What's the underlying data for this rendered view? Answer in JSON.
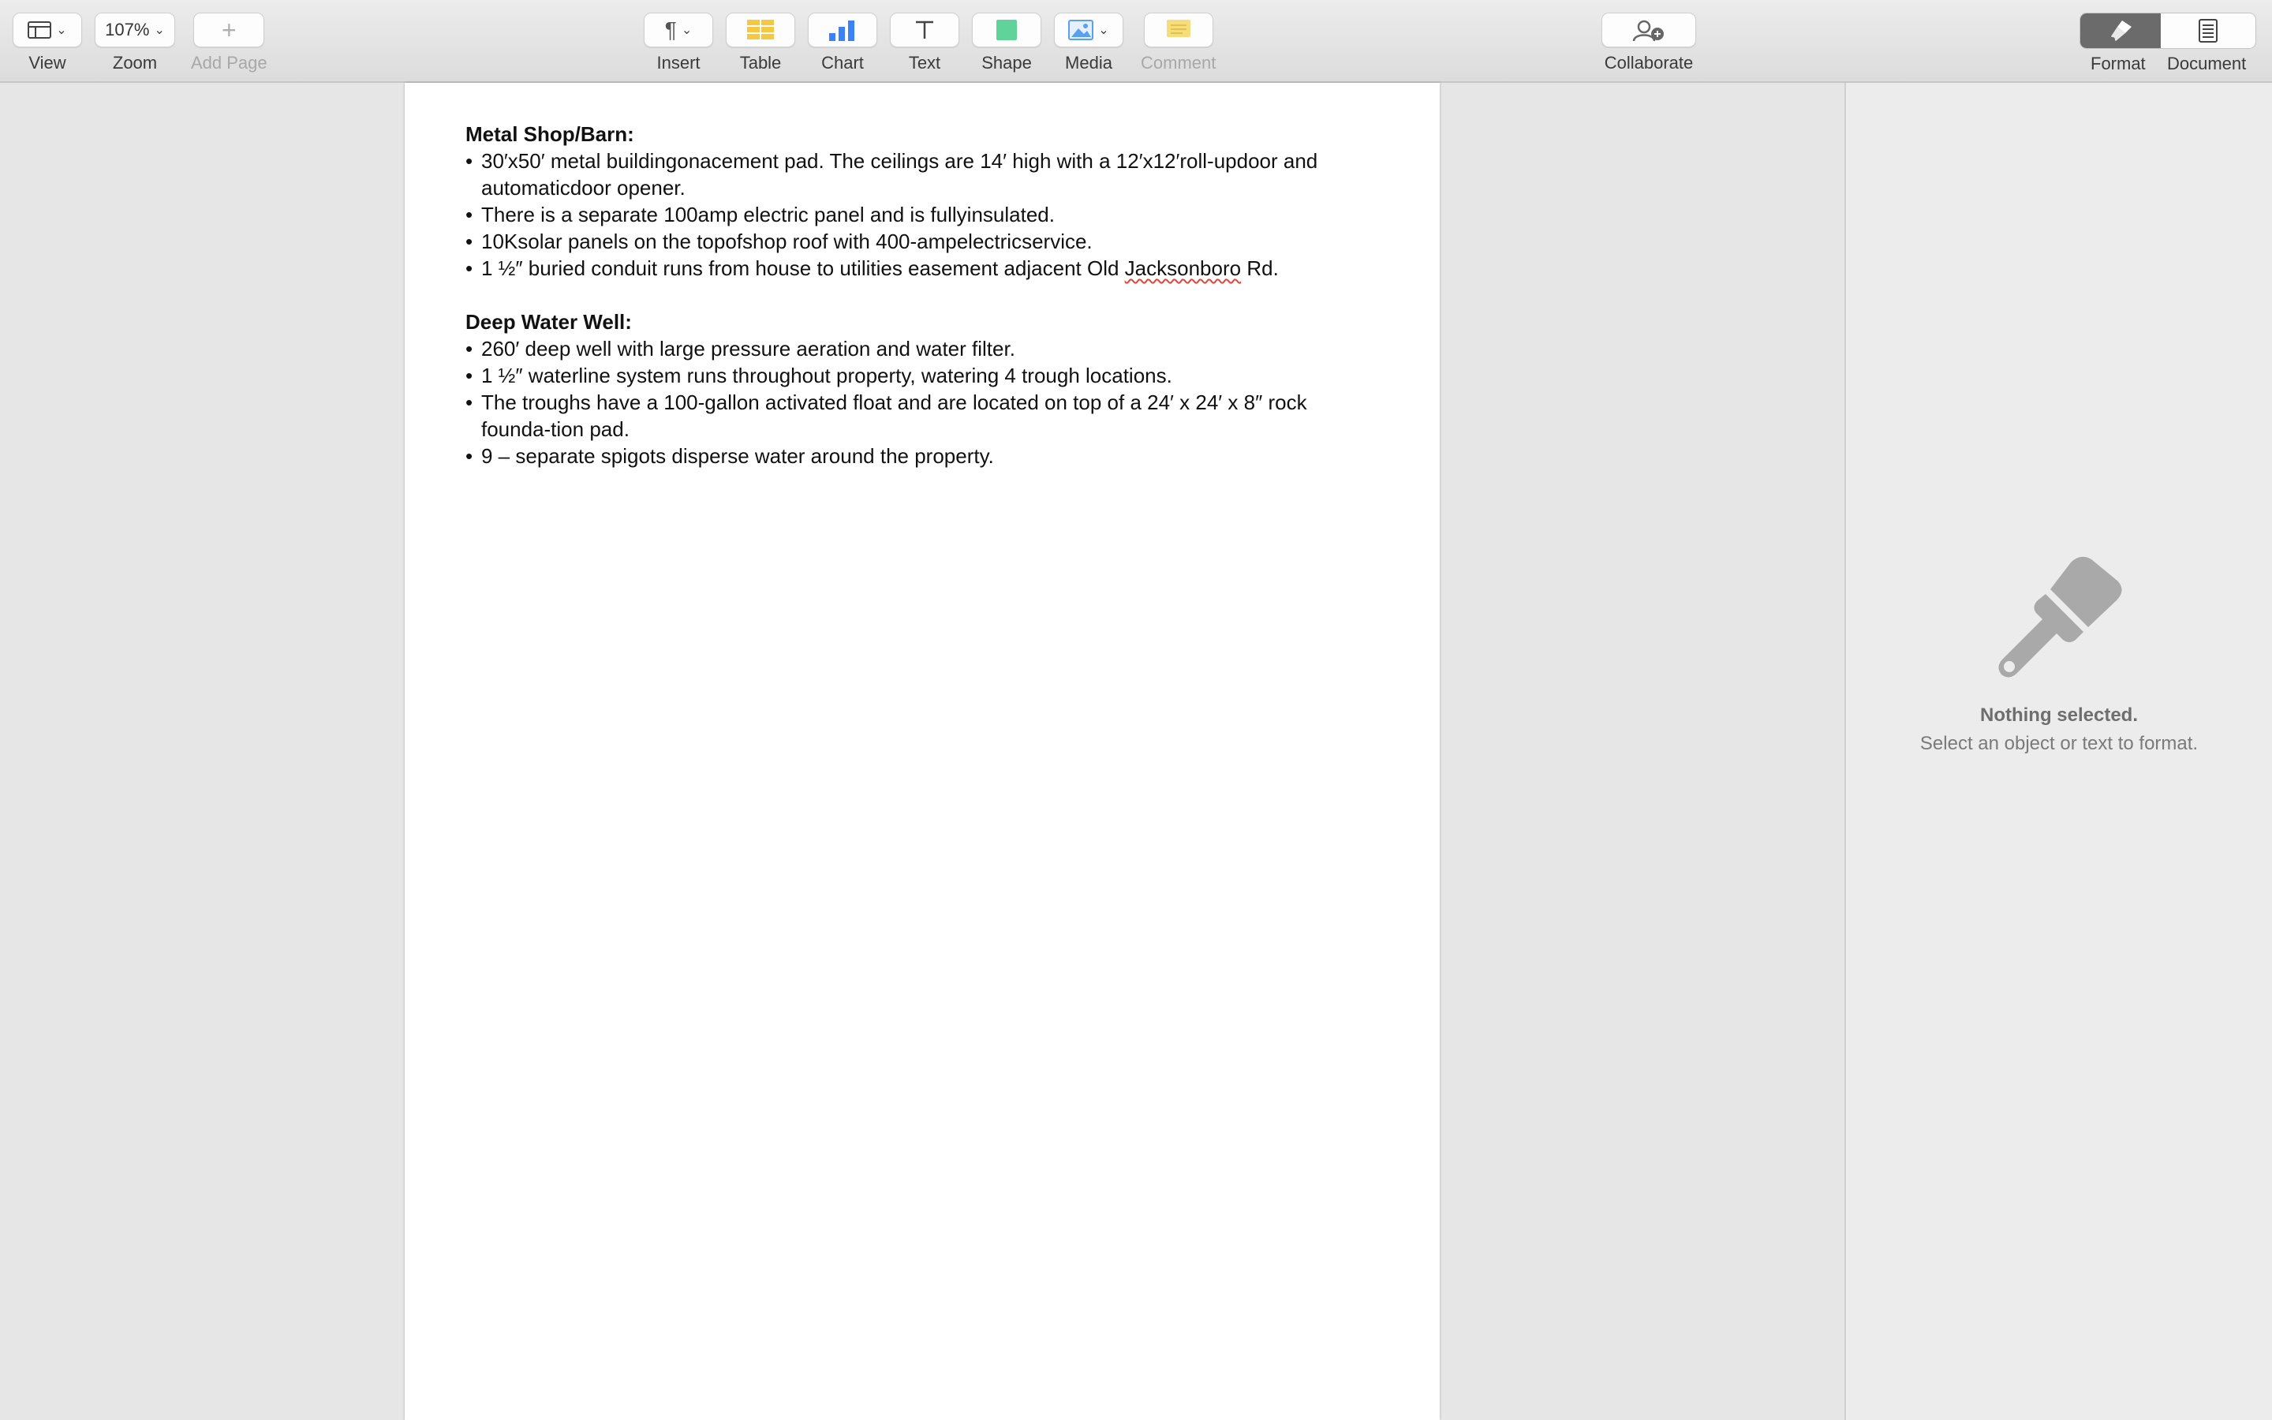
{
  "toolbar": {
    "view_label": "View",
    "zoom_label": "Zoom",
    "zoom_value": "107%",
    "add_page_label": "Add Page",
    "insert_label": "Insert",
    "table_label": "Table",
    "chart_label": "Chart",
    "text_label": "Text",
    "shape_label": "Shape",
    "media_label": "Media",
    "comment_label": "Comment",
    "collaborate_label": "Collaborate",
    "format_label": "Format",
    "document_label": "Document",
    "colors": {
      "table": "#f5c842",
      "chart": "#3b82f6",
      "shape": "#5fd39a",
      "media": "#5aa0f0",
      "comment": "#f7dc7a"
    }
  },
  "document": {
    "section1": {
      "heading": "Metal Shop/Barn:",
      "bullets": [
        "30′x50′ metal buildingonacement pad.  The ceilings are 14′ high with a 12′x12′roll-updoor and automaticdoor opener.",
        "There is a separate 100amp  electric panel and is fullyinsulated.",
        "10Ksolar panels on the topofshop roof with 400-ampelectricservice.",
        "1 ½″ buried conduit runs from house to utilities easement adjacent Old",
        "Jacksonboro",
        "Rd."
      ]
    },
    "section2": {
      "heading": "Deep Water Well:",
      "bullets": [
        "260′ deep well with large pressure aeration and water filter.",
        "1 ½″ waterline system runs throughout property, watering 4  trough locations.",
        "The troughs have a 100-gallon activated float and are located on top of a 24′ x 24′ x 8″ rock founda-tion pad.",
        "9 – separate spigots disperse water around the  property."
      ]
    },
    "bullet_char": "•"
  },
  "inspector": {
    "title": "Nothing selected.",
    "subtitle": "Select an object or text to format."
  }
}
